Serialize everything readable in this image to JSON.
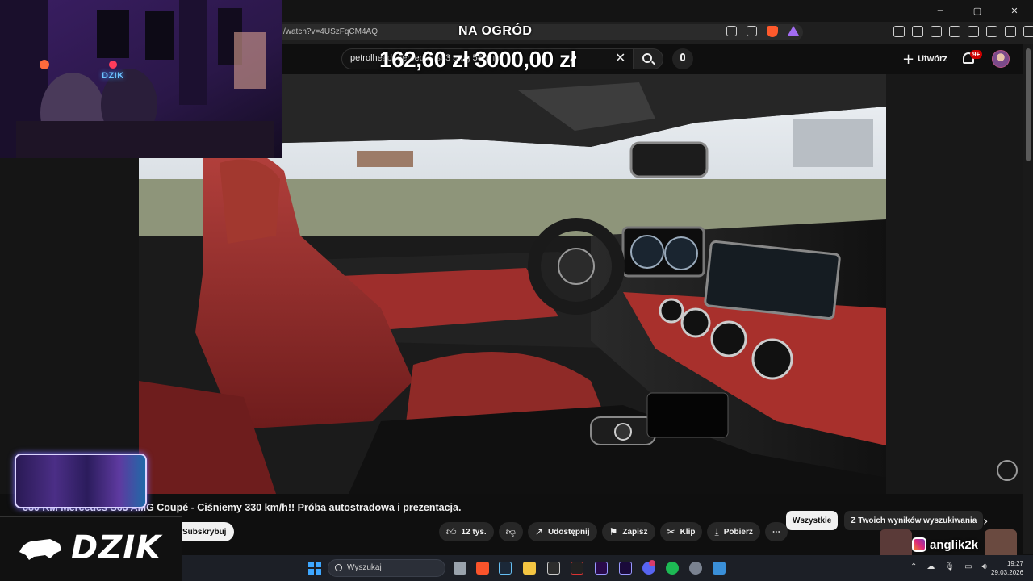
{
  "browser": {
    "url": "/watch?v=4USzFqCM4AQ",
    "window_controls": [
      "─",
      "▢",
      "✕"
    ]
  },
  "overlay": {
    "goal_label": "NA OGRÓD",
    "amount_text": "162,60 zł 3000,00 zł"
  },
  "youtube": {
    "search_value": "petrolhead mercedes s63 amg 580 hp",
    "create_label": "Utwórz",
    "notification_badge": "9+",
    "video_title": "880 KM Mercedes S63 AMG Coupé - Ciśniemy 330 km/h!! Próba autostradowa i prezentacja.",
    "subscribe_label": "Subskrybuj",
    "actions": {
      "likes": "12 tys.",
      "share": "Udostępnij",
      "save": "Zapisz",
      "clip": "Klip",
      "download": "Pobierz",
      "more": "⋯"
    },
    "chips": [
      "Wszystkie",
      "Z Twoich wyników wyszukiwania"
    ],
    "chip_next": "›"
  },
  "stream": {
    "webcam_logo": "DZIK",
    "banner_text": "DZIK",
    "instagram_handle": "anglik2k"
  },
  "taskbar": {
    "search_placeholder": "Wyszukaj",
    "clock_time": "19:27",
    "clock_date": "29.03.2026"
  },
  "colors": {
    "youtube_bg": "#0f0f0f",
    "pill_bg": "#272727",
    "accent_red": "#cc0000",
    "leather_red": "#a52a2a"
  }
}
